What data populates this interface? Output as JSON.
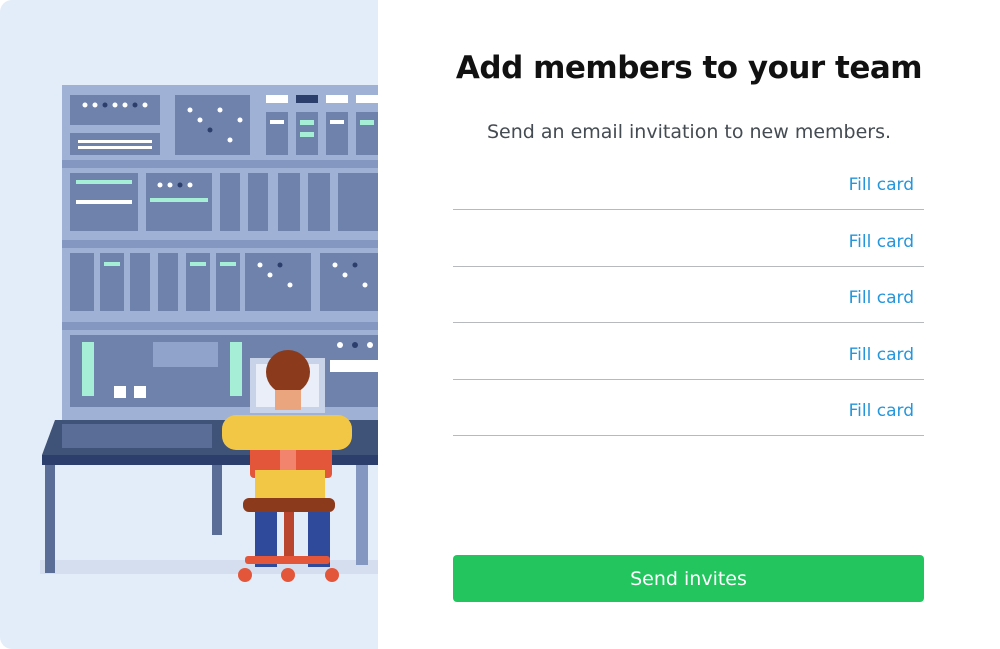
{
  "dialog": {
    "title": "Add members to your team",
    "subtitle": "Send an email invitation to new members."
  },
  "fields": [
    {
      "value": "",
      "placeholder": "",
      "action_label": "Fill card"
    },
    {
      "value": "",
      "placeholder": "",
      "action_label": "Fill card"
    },
    {
      "value": "",
      "placeholder": "",
      "action_label": "Fill card"
    },
    {
      "value": "",
      "placeholder": "",
      "action_label": "Fill card"
    },
    {
      "value": "",
      "placeholder": "",
      "action_label": "Fill card"
    }
  ],
  "actions": {
    "send_label": "Send invites"
  },
  "colors": {
    "accent_link": "#2496dc",
    "primary_button": "#22c55e",
    "illustration_bg": "#e3ecf9"
  }
}
